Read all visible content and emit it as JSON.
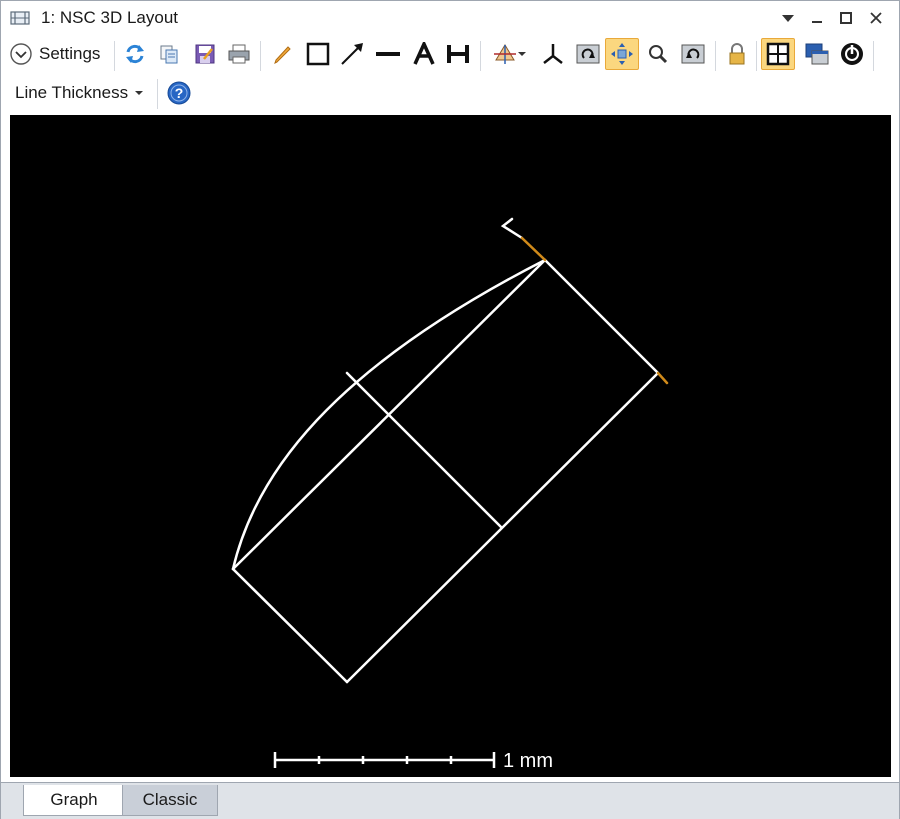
{
  "window": {
    "title": "1: NSC 3D Layout"
  },
  "toolbar": {
    "settings_label": "Settings",
    "line_thickness_label": "Line Thickness",
    "icons": [
      "refresh-icon",
      "copy-icon",
      "save-icon",
      "print-icon",
      "pencil-icon",
      "rectangle-icon",
      "arrow-icon",
      "line-icon",
      "text-icon",
      "dimension-icon",
      "rotate-3d-icon",
      "axes-icon",
      "rotate-view-icon",
      "pan-icon",
      "zoom-icon",
      "reset-view-icon",
      "lock-icon",
      "fit-window-icon",
      "float-window-icon",
      "target-icon",
      "help-icon"
    ],
    "active": [
      "pan-icon",
      "fit-window-icon"
    ]
  },
  "canvas": {
    "background": "#000000",
    "line_color": "#ffffff",
    "detector_color": "#d08a1a",
    "scale_label": "1 mm"
  },
  "tabs": [
    {
      "label": "Graph",
      "selected": true
    },
    {
      "label": "Classic",
      "selected": false
    }
  ]
}
